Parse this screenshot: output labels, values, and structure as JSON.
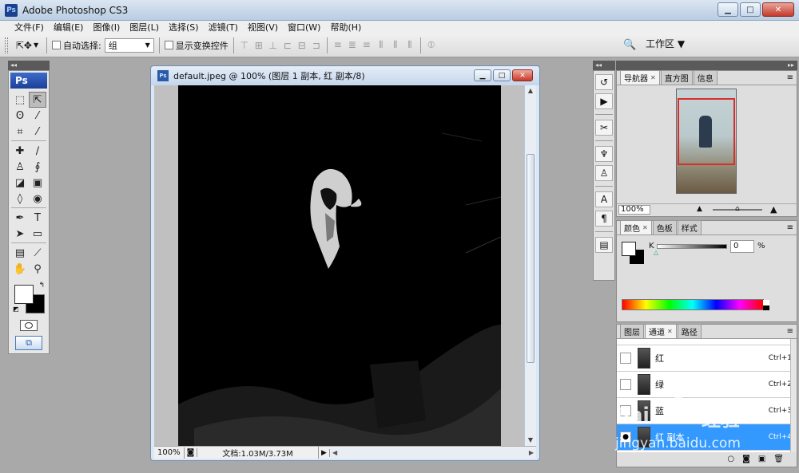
{
  "app": {
    "title": "Adobe Photoshop CS3",
    "logo": "Ps",
    "window_buttons": {
      "minimize": "▁",
      "maximize": "□",
      "close": "✕"
    }
  },
  "menubar": {
    "items": [
      "文件(F)",
      "编辑(E)",
      "图像(I)",
      "图层(L)",
      "选择(S)",
      "滤镜(T)",
      "视图(V)",
      "窗口(W)",
      "帮助(H)"
    ]
  },
  "options": {
    "auto_select_label": "自动选择:",
    "auto_select_value": "组",
    "show_transform_label": "显示变换控件",
    "workspace_label": "工作区 ▼"
  },
  "toolbox": {
    "logo": "Ps"
  },
  "document": {
    "title": "default.jpeg @ 100% (图层 1 副本, 红 副本/8)",
    "zoom": "100%",
    "doc_info": "文档:1.03M/3.73M"
  },
  "navigator": {
    "tabs": [
      "导航器",
      "直方图",
      "信息"
    ],
    "zoom": "100%"
  },
  "color_panel": {
    "tabs": [
      "颜色",
      "色板",
      "样式"
    ],
    "channel_label": "K",
    "value": "0",
    "unit": "%"
  },
  "channels_panel": {
    "tabs": [
      "图层",
      "通道",
      "路径"
    ],
    "rows": [
      {
        "name": "红",
        "shortcut": "Ctrl+1",
        "visible": false,
        "selected": false
      },
      {
        "name": "绿",
        "shortcut": "Ctrl+2",
        "visible": false,
        "selected": false
      },
      {
        "name": "蓝",
        "shortcut": "Ctrl+3",
        "visible": false,
        "selected": false
      },
      {
        "name": "红 副本",
        "shortcut": "Ctrl+4",
        "visible": true,
        "selected": true
      }
    ]
  },
  "watermark": {
    "brand": "Bai",
    "brand2": "经验",
    "url": "jingyan.baidu.com"
  },
  "colors": {
    "selection": "#3399ff",
    "nav_box": "#e02b2b",
    "canvas": "#000000"
  }
}
